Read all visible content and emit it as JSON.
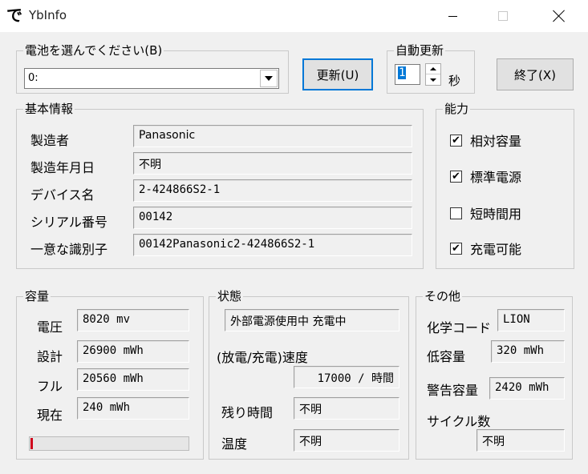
{
  "window": {
    "title": "YbInfo",
    "app_icon_glyph": "で"
  },
  "battery_select": {
    "legend": "電池を選んでください(B)",
    "selected": "0:"
  },
  "buttons": {
    "refresh": "更新(U)",
    "exit": "終了(X)"
  },
  "auto_update": {
    "legend": "自動更新",
    "value": "1",
    "unit": "秒"
  },
  "basic_info": {
    "legend": "基本情報",
    "rows": [
      {
        "label": "製造者",
        "value": "Panasonic"
      },
      {
        "label": "製造年月日",
        "value": "不明"
      },
      {
        "label": "デバイス名",
        "value": "2-424866S2-1"
      },
      {
        "label": "シリアル番号",
        "value": "00142"
      },
      {
        "label": "一意な識別子",
        "value": "00142Panasonic2-424866S2-1"
      }
    ]
  },
  "capabilities": {
    "legend": "能力",
    "items": [
      {
        "label": "相対容量",
        "checked": true
      },
      {
        "label": "標準電源",
        "checked": true
      },
      {
        "label": "短時間用",
        "checked": false
      },
      {
        "label": "充電可能",
        "checked": true
      }
    ]
  },
  "capacity": {
    "legend": "容量",
    "rows": [
      {
        "label": "電圧",
        "value": "8020 mv"
      },
      {
        "label": "設計",
        "value": "26900 mWh"
      },
      {
        "label": "フル",
        "value": "20560 mWh"
      },
      {
        "label": "現在",
        "value": "240 mWh"
      }
    ],
    "level_fraction": 0.012,
    "level_color": "#d0021b"
  },
  "status": {
    "legend": "状態",
    "state": "外部電源使用中 充電中",
    "rate_label": "(放電/充電)速度",
    "rate_value": "17000 / 時間",
    "remaining_label": "残り時間",
    "remaining_value": "不明",
    "temp_label": "温度",
    "temp_value": "不明"
  },
  "other": {
    "legend": "その他",
    "chemistry_label": "化学コード",
    "chemistry_value": "LION",
    "low_label": "低容量",
    "low_value": "320 mWh",
    "warn_label": "警告容量",
    "warn_value": "2420 mWh",
    "cycle_label": "サイクル数",
    "cycle_value": "不明"
  }
}
